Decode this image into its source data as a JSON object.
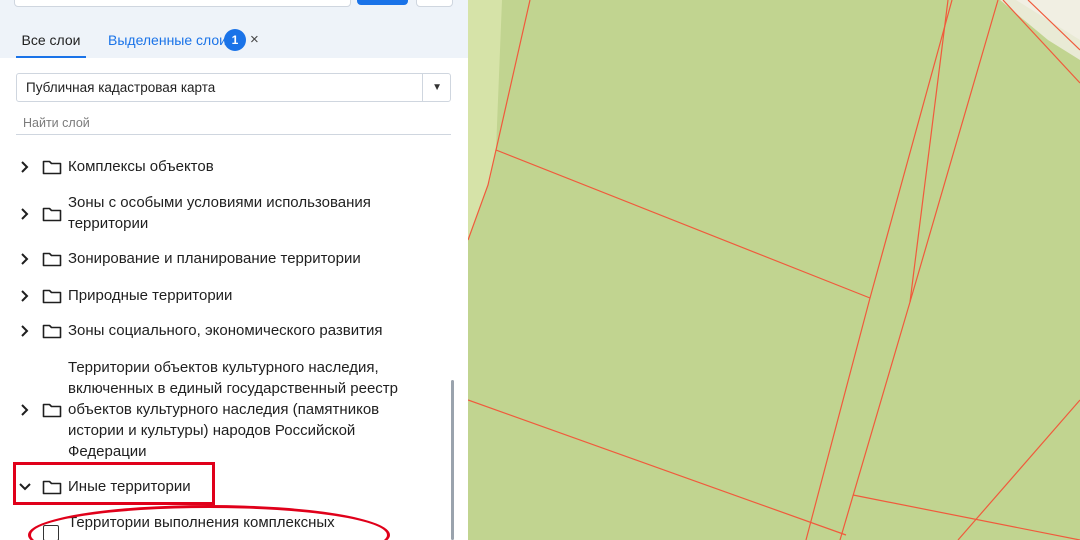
{
  "tabs": {
    "all_layers": "Все слои",
    "selected_layers": "Выделенные слои",
    "selected_count": "1",
    "close_symbol": "×"
  },
  "layer_source": {
    "selected": "Публичная кадастровая карта",
    "arrow": "▼"
  },
  "layer_search": {
    "placeholder": "Найти слой",
    "value": ""
  },
  "tree": [
    {
      "label": "Комплексы объектов",
      "expanded": false
    },
    {
      "label": "Зоны с особыми условиями использования территории",
      "expanded": false
    },
    {
      "label": "Зонирование и планирование территории",
      "expanded": false
    },
    {
      "label": "Природные территории",
      "expanded": false
    },
    {
      "label": "Зоны социального, экономического развития",
      "expanded": false
    },
    {
      "label": "Территории объектов культурного наследия, включенных в единый государственный реестр объектов культурного наследия (памятников истории и культуры) народов Российской Федерации",
      "expanded": false
    },
    {
      "label": "Иные территории",
      "expanded": true
    },
    {
      "label": "Территории выполнения комплексных",
      "checked": false
    }
  ],
  "colors": {
    "accent": "#1a73e8",
    "map_fill": "#c1d490",
    "parcel_border": "#f05a3c",
    "annotation": "#e0001a"
  },
  "icons": {
    "chevron_collapsed": "chevron-right-icon",
    "chevron_expanded": "chevron-down-icon",
    "folder": "folder-icon"
  }
}
